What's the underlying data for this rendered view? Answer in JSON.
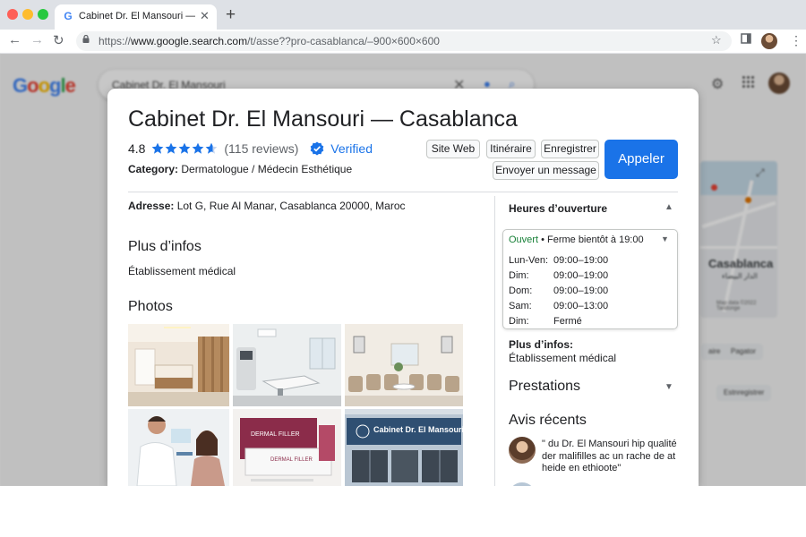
{
  "browser": {
    "tab_title": "Cabinet Dr. El Mansouri — C",
    "tab_favicon": "G",
    "url_scheme": "https://",
    "url_host": "www.google.search.com",
    "url_path": "/t/asse??pro-casablanca/–900×600×600"
  },
  "background": {
    "search_query": "Cabinet Dr. El Mansouri",
    "map_city": "Casablanca",
    "map_city_ar": "الدار البيضاء",
    "map_copyright": "Map data ©2022  Tandonge",
    "chip_1": "aire",
    "chip_2": "Pagator",
    "chip_3": "Estnregistrer",
    "logo_letters": [
      "G",
      "o",
      "o",
      "g",
      "l",
      "e"
    ]
  },
  "panel": {
    "title": "Cabinet Dr. El Mansouri — Casablanca",
    "rating": "4.8",
    "reviews": "(115 reviews)",
    "verified": "Verified",
    "category_label": "Category:",
    "category_value": " Dermatologue / Médecin Esthétique",
    "buttons": {
      "website": "Site Web",
      "directions": "Itinéraire",
      "save": "Enregistrer",
      "message": "Envoyer un message",
      "call": "Appeler"
    },
    "address_label": "Adresse:",
    "address_value": " Lot G, Rue Al Manar, Casablanca 20000, Maroc",
    "more_info_heading": "Plus d’infos",
    "more_info_value": "Établissement médical",
    "photos_heading": "Photos",
    "photo_storefront_sign": "Cabinet Dr. El Mansouri",
    "photo_product_label": "DERMAL FILLER",
    "hours": {
      "heading": "Heures d’ouverture",
      "status_open": "Ouvert",
      "status_rest": " • Ferme bientôt à 19:00",
      "rows": [
        {
          "day": "Lun-Ven:",
          "time": "09:00–19:00"
        },
        {
          "day": "Dim:",
          "time": "09:00–19:00"
        },
        {
          "day": "Dom:",
          "time": "09:00–19:00"
        },
        {
          "day": "Sam:",
          "time": "09:00–13:00"
        },
        {
          "day": "Dim:",
          "time": "Fermé"
        }
      ]
    },
    "right_more_info_label": "Plus d’infos:",
    "right_more_info_value": "Établissement médical",
    "services_heading": "Prestations",
    "reviews_heading": "Avis récents",
    "review_1": "\" du Dr. El Mansouri hip qualité der malifilles ac un rache de at heide en ethioote\""
  },
  "colors": {
    "accent": "#1a73e8",
    "open_green": "#188038",
    "star_blue": "#1a73e8"
  }
}
